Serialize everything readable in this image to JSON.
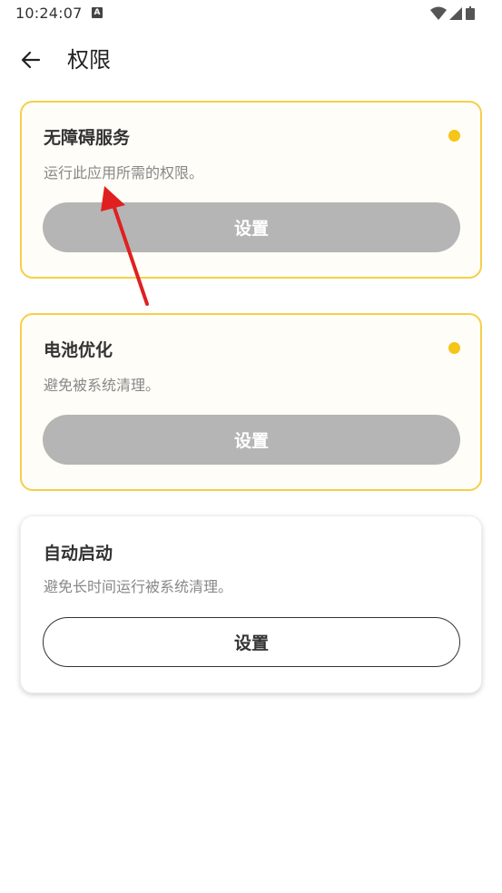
{
  "status_bar": {
    "time": "10:24:07",
    "notification_icon": "A",
    "icons": [
      "wifi-icon",
      "signal-icon",
      "battery-icon"
    ]
  },
  "app_bar": {
    "back_icon": "arrow-left-icon",
    "title": "权限"
  },
  "cards": [
    {
      "title": "无障碍服务",
      "description": "运行此应用所需的权限。",
      "button_label": "设置",
      "status": "pending",
      "dot_color": "#f5c518"
    },
    {
      "title": "电池优化",
      "description": "避免被系统清理。",
      "button_label": "设置",
      "status": "pending",
      "dot_color": "#f5c518"
    },
    {
      "title": "自动启动",
      "description": "避免长时间运行被系统清理。",
      "button_label": "设置",
      "status": "normal"
    }
  ],
  "colors": {
    "accent": "#f5c518",
    "pending_border": "#f5cf4a",
    "annotation_arrow": "#e02020",
    "disabled_button": "#b5b5b5"
  }
}
